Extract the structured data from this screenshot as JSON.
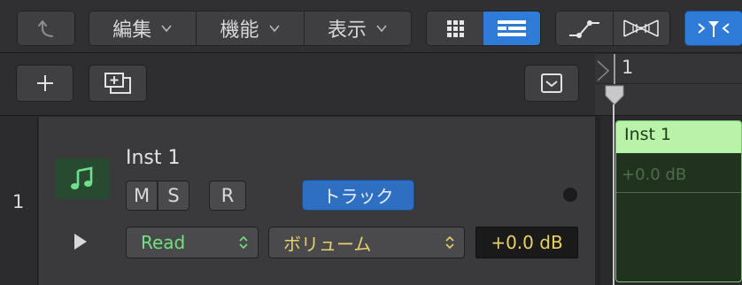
{
  "toolbar": {
    "menus": [
      {
        "label": "編集"
      },
      {
        "label": "機能"
      },
      {
        "label": "表示"
      }
    ]
  },
  "ruler": {
    "bar_number": "1"
  },
  "track": {
    "number": "1",
    "name": "Inst 1",
    "mute_label": "M",
    "solo_label": "S",
    "record_label": "R",
    "track_button_label": "トラック",
    "automation_mode": "Read",
    "automation_parameter": "ボリューム",
    "automation_value": "+0.0 dB"
  },
  "region": {
    "name": "Inst 1",
    "value_label": "+0.0 dB"
  },
  "colors": {
    "accent_blue": "#2f7bd8",
    "region_header": "#b9f2a9",
    "read_green": "#72e27e",
    "param_yellow": "#e8d06a"
  }
}
